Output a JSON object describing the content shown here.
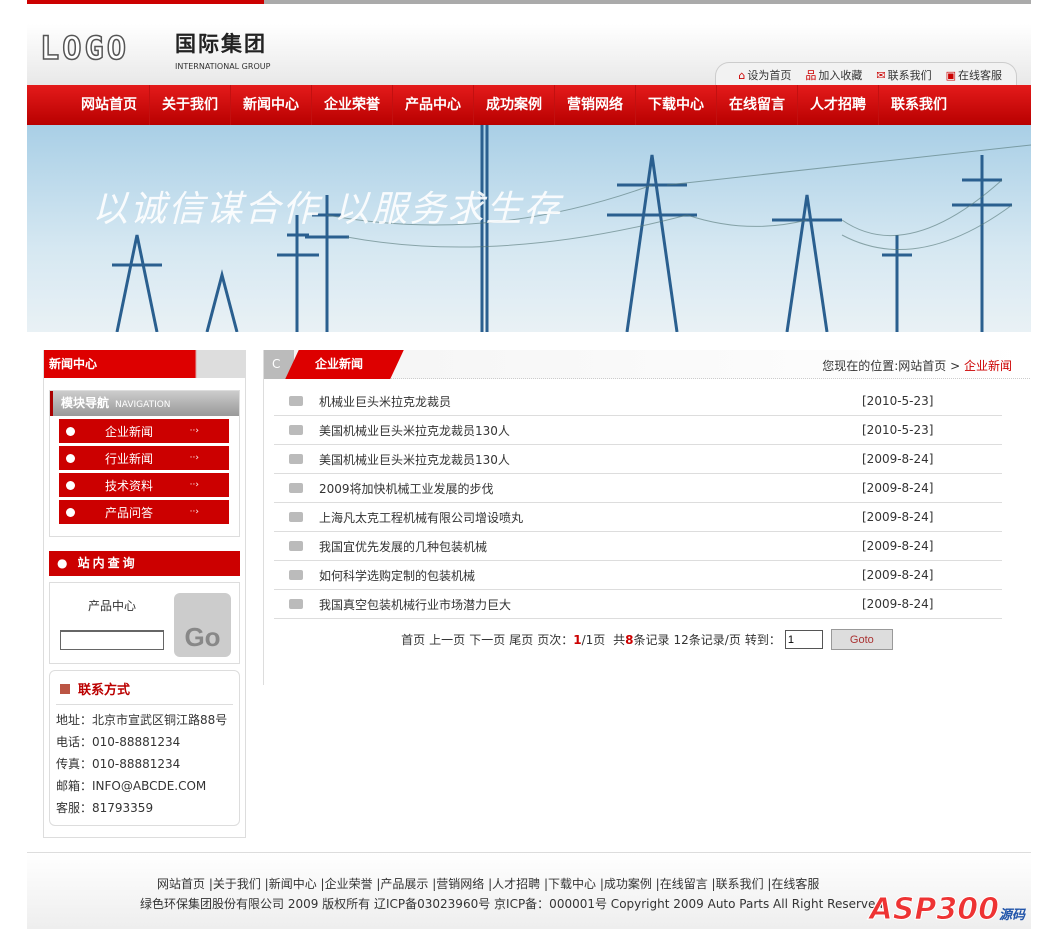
{
  "header": {
    "logo": "LOGO",
    "brand_cn": "国际集团",
    "brand_en": "INTERNATIONAL GROUP",
    "toplinks": [
      {
        "icon": "home-icon",
        "label": "设为首页"
      },
      {
        "icon": "bookmark-icon",
        "label": "加入收藏"
      },
      {
        "icon": "mail-icon",
        "label": "联系我们"
      },
      {
        "icon": "chat-icon",
        "label": "在线客服"
      }
    ]
  },
  "nav": [
    "网站首页",
    "关于我们",
    "新闻中心",
    "企业荣誉",
    "产品中心",
    "成功案例",
    "营销网络",
    "下载中心",
    "在线留言",
    "人才招聘",
    "联系我们"
  ],
  "banner": {
    "slogan": "以诚信谋合作 以服务求生存"
  },
  "sidebar": {
    "title": "新闻中心",
    "module_title": "模块导航",
    "module_en": "NAVIGATION",
    "items": [
      "企业新闻",
      "行业新闻",
      "技术资料",
      "产品问答"
    ],
    "search": {
      "title": "站内查询",
      "label": "产品中心",
      "value": "",
      "button": "Go"
    },
    "contact": {
      "title": "联系方式",
      "lines": [
        "地址：北京市宣武区铜江路88号",
        "电话：010-88881234",
        "传真：010-88881234",
        "邮箱：INFO@ABCDE.COM",
        "客服：81793359"
      ]
    }
  },
  "main": {
    "tab_letter": "C",
    "title": "企业新闻",
    "crumb_prefix": "您现在的位置:网站首页 >",
    "crumb_current": "企业新闻",
    "news": [
      {
        "title": "机械业巨头米拉克龙裁员",
        "date": "[2010-5-23]"
      },
      {
        "title": "美国机械业巨头米拉克龙裁员130人",
        "date": "[2010-5-23]"
      },
      {
        "title": "美国机械业巨头米拉克龙裁员130人",
        "date": "[2009-8-24]"
      },
      {
        "title": "2009将加快机械工业发展的步伐",
        "date": "[2009-8-24]"
      },
      {
        "title": "上海凡太克工程机械有限公司增设喷丸",
        "date": "[2009-8-24]"
      },
      {
        "title": "我国宜优先发展的几种包装机械",
        "date": "[2009-8-24]"
      },
      {
        "title": "如何科学选购定制的包装机械",
        "date": "[2009-8-24]"
      },
      {
        "title": "我国真空包装机械行业市场潜力巨大",
        "date": "[2009-8-24]"
      }
    ],
    "pager": {
      "first": "首页",
      "prev": "上一页",
      "next": "下一页",
      "last": "尾页",
      "page_label": "页次：",
      "page": "1",
      "total_pages": "/1页",
      "total_prefix": "共",
      "total": "8",
      "total_suffix": "条记录",
      "per_page": "12条记录/页",
      "goto_label": "转到：",
      "goto_value": "1",
      "goto_button": "Goto"
    }
  },
  "footer": {
    "links": "网站首页 |关于我们 |新闻中心 |企业荣誉 |产品展示 |营销网络 |人才招聘 |下载中心 |成功案例 |在线留言 |联系我们 |在线客服",
    "copyright": "绿色环保集团股份有限公司 2009 版权所有 辽ICP备03023960号 京ICP备：000001号 Copyright 2009 Auto Parts All Right Reserved",
    "watermark": "ASP300",
    "watermark_sub": "源码 .com"
  }
}
